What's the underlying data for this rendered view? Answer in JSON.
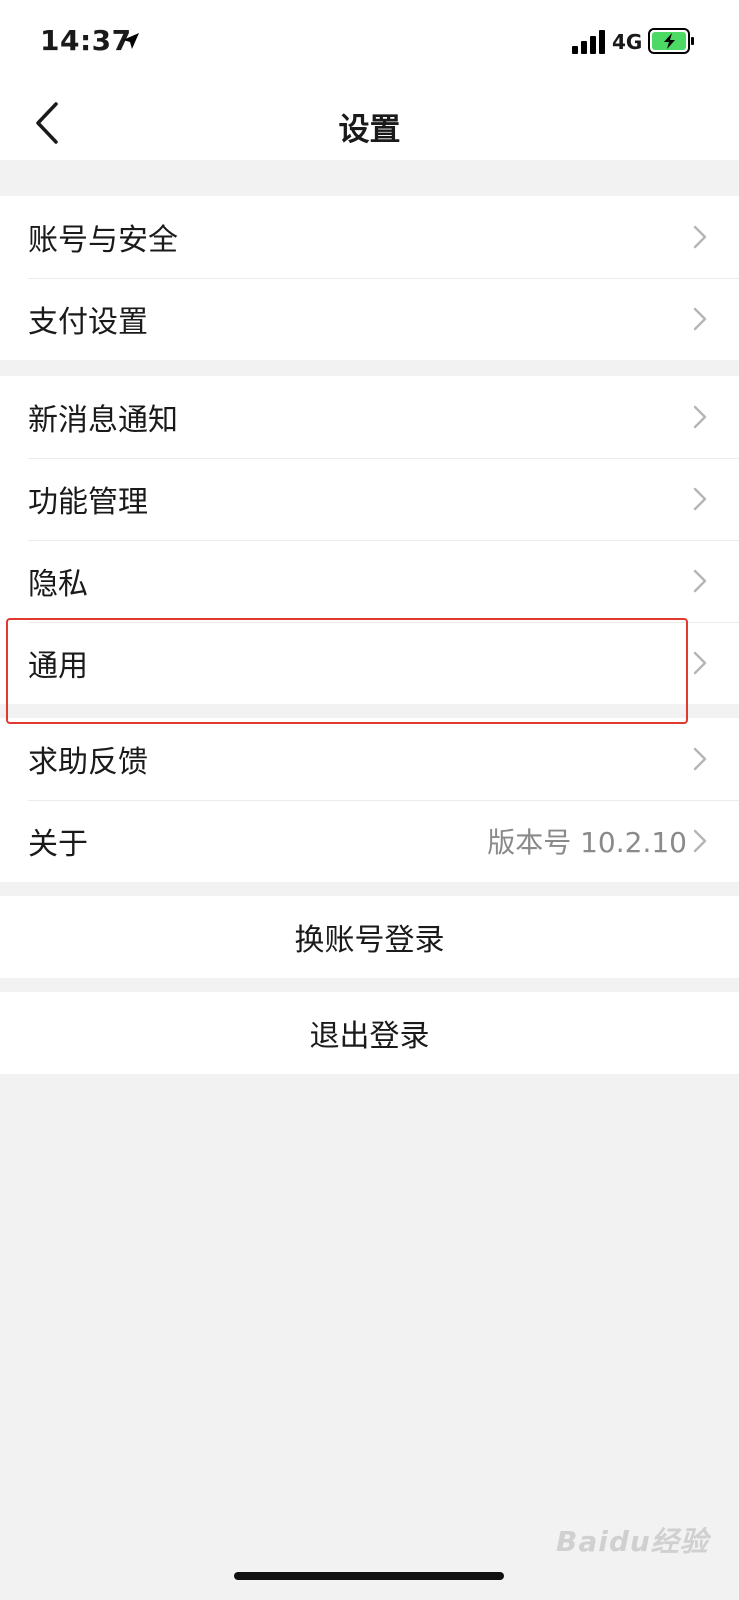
{
  "status": {
    "time": "14:37",
    "network": "4G"
  },
  "nav": {
    "title": "设置"
  },
  "groups": [
    [
      {
        "label": "账号与安全"
      },
      {
        "label": "支付设置"
      }
    ],
    [
      {
        "label": "新消息通知"
      },
      {
        "label": "功能管理"
      },
      {
        "label": "隐私"
      },
      {
        "label": "通用"
      }
    ],
    [
      {
        "label": "求助反馈"
      },
      {
        "label": "关于",
        "value": "版本号 10.2.10"
      }
    ]
  ],
  "actions": {
    "switch_account": "换账号登录",
    "logout": "退出登录"
  },
  "watermark": "Baidu经验",
  "colors": {
    "highlight": "#e03a2f",
    "background": "#f2f2f2",
    "value_text": "#8a8a8a"
  }
}
